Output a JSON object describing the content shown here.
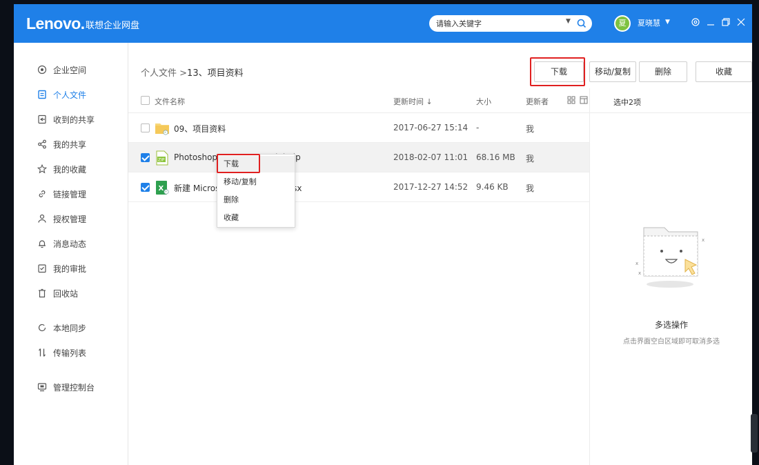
{
  "app": {
    "logo": "Lenovo.",
    "name": "联想企业网盘"
  },
  "search": {
    "placeholder": "请输入关键字"
  },
  "user": {
    "avatar_text": "夏",
    "name": "夏晓慧"
  },
  "sidebar": {
    "items": [
      {
        "label": "企业空间",
        "icon": "enterprise-space-icon"
      },
      {
        "label": "个人文件",
        "icon": "personal-files-icon",
        "active": true
      },
      {
        "label": "收到的共享",
        "icon": "received-share-icon"
      },
      {
        "label": "我的共享",
        "icon": "share-icon"
      },
      {
        "label": "我的收藏",
        "icon": "star-icon"
      },
      {
        "label": "链接管理",
        "icon": "link-icon"
      },
      {
        "label": "授权管理",
        "icon": "user-auth-icon"
      },
      {
        "label": "消息动态",
        "icon": "bell-icon"
      },
      {
        "label": "我的审批",
        "icon": "approval-icon"
      },
      {
        "label": "回收站",
        "icon": "trash-icon"
      },
      {
        "label": "本地同步",
        "icon": "sync-icon"
      },
      {
        "label": "传输列表",
        "icon": "transfer-icon"
      },
      {
        "label": "管理控制台",
        "icon": "console-icon"
      }
    ]
  },
  "breadcrumb": {
    "root": "个人文件",
    "sep": " >",
    "current": "13、项目资料"
  },
  "toolbar": {
    "download": "下载",
    "move_copy": "移动/复制",
    "delete": "删除",
    "favorite": "收藏"
  },
  "table": {
    "headers": {
      "name": "文件名称",
      "time": "更新时间 ↓",
      "size": "大小",
      "updater": "更新者"
    },
    "rows": [
      {
        "name": "09、项目资料",
        "time": "2017-06-27 15:14",
        "size": "-",
        "updater": "我",
        "type": "folder",
        "checked": false
      },
      {
        "name": "Photoshop_CS4_11.0AB (1).zip",
        "time": "2018-02-07 11:01",
        "size": "68.16 MB",
        "updater": "我",
        "type": "zip",
        "checked": true
      },
      {
        "name": "新建 Microsoft Excel 工作表.xlsx",
        "time": "2017-12-27 14:52",
        "size": "9.46 KB",
        "updater": "我",
        "type": "excel",
        "checked": true
      }
    ]
  },
  "context_menu": {
    "items": [
      "下载",
      "移动/复制",
      "删除",
      "收藏"
    ]
  },
  "right_panel": {
    "title": "选中2项",
    "empty_title": "多选操作",
    "empty_sub": "点击界面空白区域即可取消多选"
  },
  "colors": {
    "brand": "#1f80e8",
    "highlight": "#e02020",
    "avatar": "#7ec241"
  }
}
